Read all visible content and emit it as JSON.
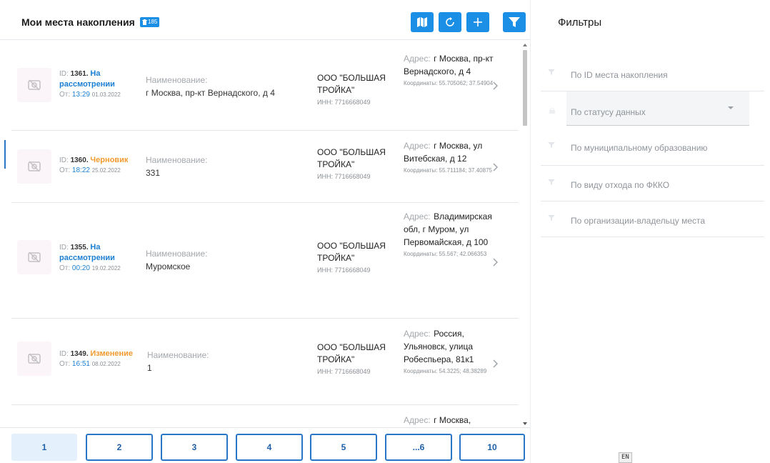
{
  "header": {
    "title": "Мои места накопления",
    "badge_count": "185"
  },
  "icons": {
    "map": "map-icon",
    "refresh": "refresh-icon",
    "add": "plus-icon",
    "filter": "filter-icon",
    "trash": "trash-icon"
  },
  "colors": {
    "accent": "#1b8ee5",
    "status_review": "#1b7fd3",
    "status_draft": "#f29a2e",
    "page_border": "#2a76c6"
  },
  "labels": {
    "id_prefix": "ID: ",
    "from_prefix": "От: ",
    "name_label": "Наименование:",
    "address_label": "Адрес:",
    "coords_label": "Координаты:",
    "inn_prefix": "ИНН: "
  },
  "rows": [
    {
      "id": "1361",
      "status": "На рассмотрении",
      "time": "13:29",
      "date": "01.03.2022",
      "name": "г Москва, пр-кт Вернадского, д 4",
      "org": "ООО \"БОЛЬШАЯ ТРОЙКА\"",
      "inn": "7716668049",
      "address": "г Москва, пр-кт Вернадского, д 4",
      "coords": "55.705062; 37.54904"
    },
    {
      "id": "1360",
      "status": "Черновик",
      "time": "18:22",
      "date": "25.02.2022",
      "name": "331",
      "org": "ООО \"БОЛЬШАЯ ТРОЙКА\"",
      "inn": "7716668049",
      "address": "г Москва, ул Витебская, д 12",
      "coords": "55.711184; 37.40875"
    },
    {
      "id": "1355",
      "status": "На рассмотрении",
      "time": "00:20",
      "date": "19.02.2022",
      "name": "Муромское",
      "org": "ООО \"БОЛЬШАЯ ТРОЙКА\"",
      "inn": "7716668049",
      "address": "Владимирская обл, г Муром, ул Первомайская, д 100",
      "coords": "55.567; 42.066353"
    },
    {
      "id": "1349",
      "status": "Изменение",
      "time": "16:51",
      "date": "08.02.2022",
      "name": "1",
      "org": "ООО \"БОЛЬШАЯ ТРОЙКА\"",
      "inn": "7716668049",
      "address": "Россия, Ульяновск, улица Робеспьера, 81к1",
      "coords": "54.3225; 48.38289"
    },
    {
      "address": "г Москва,"
    }
  ],
  "pagination": [
    "1",
    "2",
    "3",
    "4",
    "5",
    "...6",
    "10"
  ],
  "filters": {
    "title": "Фильтры",
    "items": [
      "По ID места накопления",
      "По статусу данных",
      "По муниципальному образованию",
      "По виду отхода по ФККО",
      "По организации-владельцу места"
    ]
  },
  "lang": "EN"
}
